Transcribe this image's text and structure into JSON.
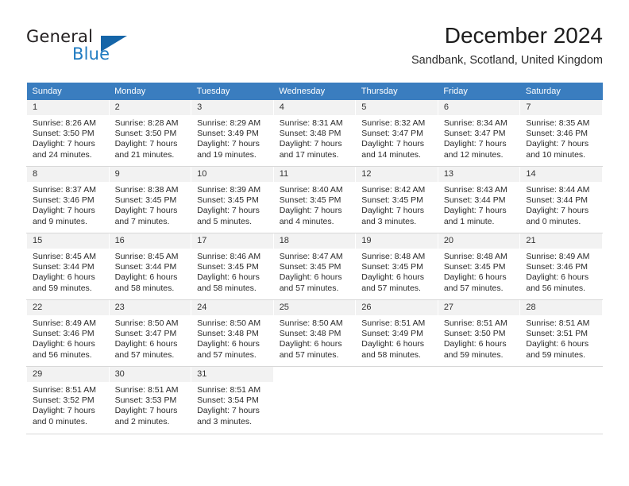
{
  "brand": {
    "name_top": "General",
    "name_bottom": "Blue",
    "logo_icon": "triangle-logo-icon"
  },
  "header": {
    "title": "December 2024",
    "subtitle": "Sandbank, Scotland, United Kingdom"
  },
  "colors": {
    "header_row_background": "#3a7dbf",
    "day_number_background": "#f2f2f2",
    "brand_blue": "#1f7bc1",
    "logo_blue": "#1565a8",
    "cell_divider": "#d8d8d8"
  },
  "weekday_headers": [
    "Sunday",
    "Monday",
    "Tuesday",
    "Wednesday",
    "Thursday",
    "Friday",
    "Saturday"
  ],
  "labels": {
    "sunrise_prefix": "Sunrise:",
    "sunset_prefix": "Sunset:",
    "daylight_prefix": "Daylight:"
  },
  "weeks": [
    [
      {
        "day": "1",
        "sunrise": "Sunrise: 8:26 AM",
        "sunset": "Sunset: 3:50 PM",
        "daylight": "Daylight: 7 hours and 24 minutes."
      },
      {
        "day": "2",
        "sunrise": "Sunrise: 8:28 AM",
        "sunset": "Sunset: 3:50 PM",
        "daylight": "Daylight: 7 hours and 21 minutes."
      },
      {
        "day": "3",
        "sunrise": "Sunrise: 8:29 AM",
        "sunset": "Sunset: 3:49 PM",
        "daylight": "Daylight: 7 hours and 19 minutes."
      },
      {
        "day": "4",
        "sunrise": "Sunrise: 8:31 AM",
        "sunset": "Sunset: 3:48 PM",
        "daylight": "Daylight: 7 hours and 17 minutes."
      },
      {
        "day": "5",
        "sunrise": "Sunrise: 8:32 AM",
        "sunset": "Sunset: 3:47 PM",
        "daylight": "Daylight: 7 hours and 14 minutes."
      },
      {
        "day": "6",
        "sunrise": "Sunrise: 8:34 AM",
        "sunset": "Sunset: 3:47 PM",
        "daylight": "Daylight: 7 hours and 12 minutes."
      },
      {
        "day": "7",
        "sunrise": "Sunrise: 8:35 AM",
        "sunset": "Sunset: 3:46 PM",
        "daylight": "Daylight: 7 hours and 10 minutes."
      }
    ],
    [
      {
        "day": "8",
        "sunrise": "Sunrise: 8:37 AM",
        "sunset": "Sunset: 3:46 PM",
        "daylight": "Daylight: 7 hours and 9 minutes."
      },
      {
        "day": "9",
        "sunrise": "Sunrise: 8:38 AM",
        "sunset": "Sunset: 3:45 PM",
        "daylight": "Daylight: 7 hours and 7 minutes."
      },
      {
        "day": "10",
        "sunrise": "Sunrise: 8:39 AM",
        "sunset": "Sunset: 3:45 PM",
        "daylight": "Daylight: 7 hours and 5 minutes."
      },
      {
        "day": "11",
        "sunrise": "Sunrise: 8:40 AM",
        "sunset": "Sunset: 3:45 PM",
        "daylight": "Daylight: 7 hours and 4 minutes."
      },
      {
        "day": "12",
        "sunrise": "Sunrise: 8:42 AM",
        "sunset": "Sunset: 3:45 PM",
        "daylight": "Daylight: 7 hours and 3 minutes."
      },
      {
        "day": "13",
        "sunrise": "Sunrise: 8:43 AM",
        "sunset": "Sunset: 3:44 PM",
        "daylight": "Daylight: 7 hours and 1 minute."
      },
      {
        "day": "14",
        "sunrise": "Sunrise: 8:44 AM",
        "sunset": "Sunset: 3:44 PM",
        "daylight": "Daylight: 7 hours and 0 minutes."
      }
    ],
    [
      {
        "day": "15",
        "sunrise": "Sunrise: 8:45 AM",
        "sunset": "Sunset: 3:44 PM",
        "daylight": "Daylight: 6 hours and 59 minutes."
      },
      {
        "day": "16",
        "sunrise": "Sunrise: 8:45 AM",
        "sunset": "Sunset: 3:44 PM",
        "daylight": "Daylight: 6 hours and 58 minutes."
      },
      {
        "day": "17",
        "sunrise": "Sunrise: 8:46 AM",
        "sunset": "Sunset: 3:45 PM",
        "daylight": "Daylight: 6 hours and 58 minutes."
      },
      {
        "day": "18",
        "sunrise": "Sunrise: 8:47 AM",
        "sunset": "Sunset: 3:45 PM",
        "daylight": "Daylight: 6 hours and 57 minutes."
      },
      {
        "day": "19",
        "sunrise": "Sunrise: 8:48 AM",
        "sunset": "Sunset: 3:45 PM",
        "daylight": "Daylight: 6 hours and 57 minutes."
      },
      {
        "day": "20",
        "sunrise": "Sunrise: 8:48 AM",
        "sunset": "Sunset: 3:45 PM",
        "daylight": "Daylight: 6 hours and 57 minutes."
      },
      {
        "day": "21",
        "sunrise": "Sunrise: 8:49 AM",
        "sunset": "Sunset: 3:46 PM",
        "daylight": "Daylight: 6 hours and 56 minutes."
      }
    ],
    [
      {
        "day": "22",
        "sunrise": "Sunrise: 8:49 AM",
        "sunset": "Sunset: 3:46 PM",
        "daylight": "Daylight: 6 hours and 56 minutes."
      },
      {
        "day": "23",
        "sunrise": "Sunrise: 8:50 AM",
        "sunset": "Sunset: 3:47 PM",
        "daylight": "Daylight: 6 hours and 57 minutes."
      },
      {
        "day": "24",
        "sunrise": "Sunrise: 8:50 AM",
        "sunset": "Sunset: 3:48 PM",
        "daylight": "Daylight: 6 hours and 57 minutes."
      },
      {
        "day": "25",
        "sunrise": "Sunrise: 8:50 AM",
        "sunset": "Sunset: 3:48 PM",
        "daylight": "Daylight: 6 hours and 57 minutes."
      },
      {
        "day": "26",
        "sunrise": "Sunrise: 8:51 AM",
        "sunset": "Sunset: 3:49 PM",
        "daylight": "Daylight: 6 hours and 58 minutes."
      },
      {
        "day": "27",
        "sunrise": "Sunrise: 8:51 AM",
        "sunset": "Sunset: 3:50 PM",
        "daylight": "Daylight: 6 hours and 59 minutes."
      },
      {
        "day": "28",
        "sunrise": "Sunrise: 8:51 AM",
        "sunset": "Sunset: 3:51 PM",
        "daylight": "Daylight: 6 hours and 59 minutes."
      }
    ],
    [
      {
        "day": "29",
        "sunrise": "Sunrise: 8:51 AM",
        "sunset": "Sunset: 3:52 PM",
        "daylight": "Daylight: 7 hours and 0 minutes."
      },
      {
        "day": "30",
        "sunrise": "Sunrise: 8:51 AM",
        "sunset": "Sunset: 3:53 PM",
        "daylight": "Daylight: 7 hours and 2 minutes."
      },
      {
        "day": "31",
        "sunrise": "Sunrise: 8:51 AM",
        "sunset": "Sunset: 3:54 PM",
        "daylight": "Daylight: 7 hours and 3 minutes."
      },
      {
        "day": "",
        "sunrise": "",
        "sunset": "",
        "daylight": ""
      },
      {
        "day": "",
        "sunrise": "",
        "sunset": "",
        "daylight": ""
      },
      {
        "day": "",
        "sunrise": "",
        "sunset": "",
        "daylight": ""
      },
      {
        "day": "",
        "sunrise": "",
        "sunset": "",
        "daylight": ""
      }
    ]
  ]
}
